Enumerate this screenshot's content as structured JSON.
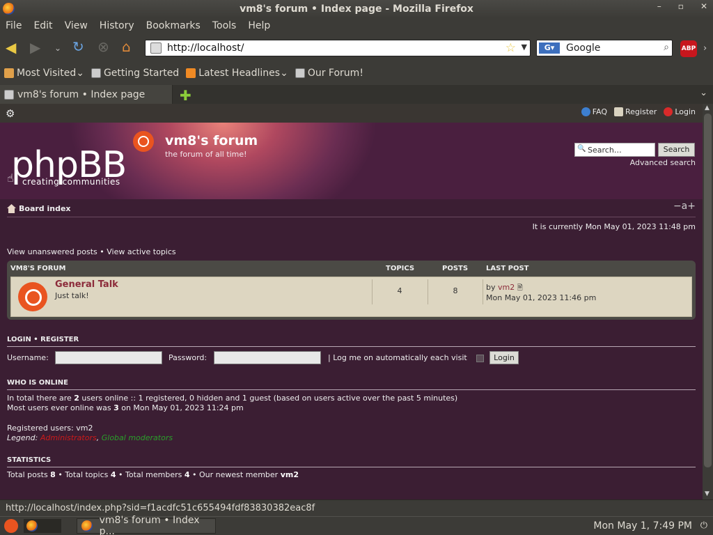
{
  "window": {
    "title": "vm8's forum • Index page - Mozilla Firefox",
    "controls": [
      "–",
      "▫",
      "✕"
    ]
  },
  "menu": [
    "File",
    "Edit",
    "View",
    "History",
    "Bookmarks",
    "Tools",
    "Help"
  ],
  "nav": {
    "url": "http://localhost/",
    "search_engine": "Google",
    "search_value": "Google",
    "adblock_label": "ABP"
  },
  "bookmarks": [
    {
      "label": "Most Visited",
      "icon": "most-visited-icon",
      "dropdown": true
    },
    {
      "label": "Getting Started",
      "icon": "page-icon",
      "dropdown": false
    },
    {
      "label": "Latest Headlines",
      "icon": "rss-icon",
      "dropdown": true
    },
    {
      "label": "Our Forum!",
      "icon": "page-icon",
      "dropdown": false
    }
  ],
  "tab": {
    "label": "vm8's forum • Index page"
  },
  "forum": {
    "toplinks": {
      "faq": "FAQ",
      "register": "Register",
      "login": "Login"
    },
    "logo_text": "phpBB",
    "logo_sub": "creating   communities",
    "site_title": "vm8's forum",
    "site_desc": "the forum of all time!",
    "search_placeholder": "Search…",
    "search_button": "Search",
    "advanced_search": "Advanced search",
    "breadcrumb": "Board index",
    "font_size": "−a+",
    "current_time": "It is currently Mon May 01, 2023 11:48 pm",
    "quicklinks": "View unanswered posts • View active topics",
    "table": {
      "headers": {
        "forum": "VM8'S FORUM",
        "topics": "TOPICS",
        "posts": "POSTS",
        "last_post": "LAST POST"
      },
      "rows": [
        {
          "name": "General Talk",
          "desc": "Just talk!",
          "topics": "4",
          "posts": "8",
          "last_by_prefix": "by",
          "last_by": "vm2",
          "last_date": "Mon May 01, 2023 11:46 pm"
        }
      ]
    },
    "login": {
      "heading": "LOGIN  •  REGISTER",
      "username_label": "Username:",
      "password_label": "Password:",
      "auto_label": "| Log me on automatically each visit",
      "button": "Login"
    },
    "online": {
      "heading": "WHO IS ONLINE",
      "line1_pre": "In total there are ",
      "line1_num": "2",
      "line1_post": " users online :: 1 registered, 0 hidden and 1 guest (based on users active over the past 5 minutes)",
      "line2_pre": "Most users ever online was ",
      "line2_num": "3",
      "line2_post": " on Mon May 01, 2023 11:24 pm",
      "registered": "Registered users: vm2",
      "legend_label": "Legend:",
      "legend_admins": "Administrators",
      "legend_sep": ", ",
      "legend_gmods": "Global moderators"
    },
    "stats": {
      "heading": "STATISTICS",
      "p1": "Total posts ",
      "posts": "8",
      "p2": " • Total topics ",
      "topics": "4",
      "p3": " • Total members ",
      "members": "4",
      "p4": " • Our newest member ",
      "newest": "vm2"
    }
  },
  "status_url": "http://localhost/index.php?sid=f1acdfc51c655494fdf83830382eac8f",
  "taskbar": {
    "task_label": "vm8's forum • Index p...",
    "clock": "Mon May  1,  7:49 PM"
  },
  "colors": {
    "page_bg": "#3b1e33",
    "accent": "#e95420",
    "forum_link": "#8c2b3a",
    "admin_color": "#cc1a1a",
    "gmod_color": "#2aa02a"
  }
}
